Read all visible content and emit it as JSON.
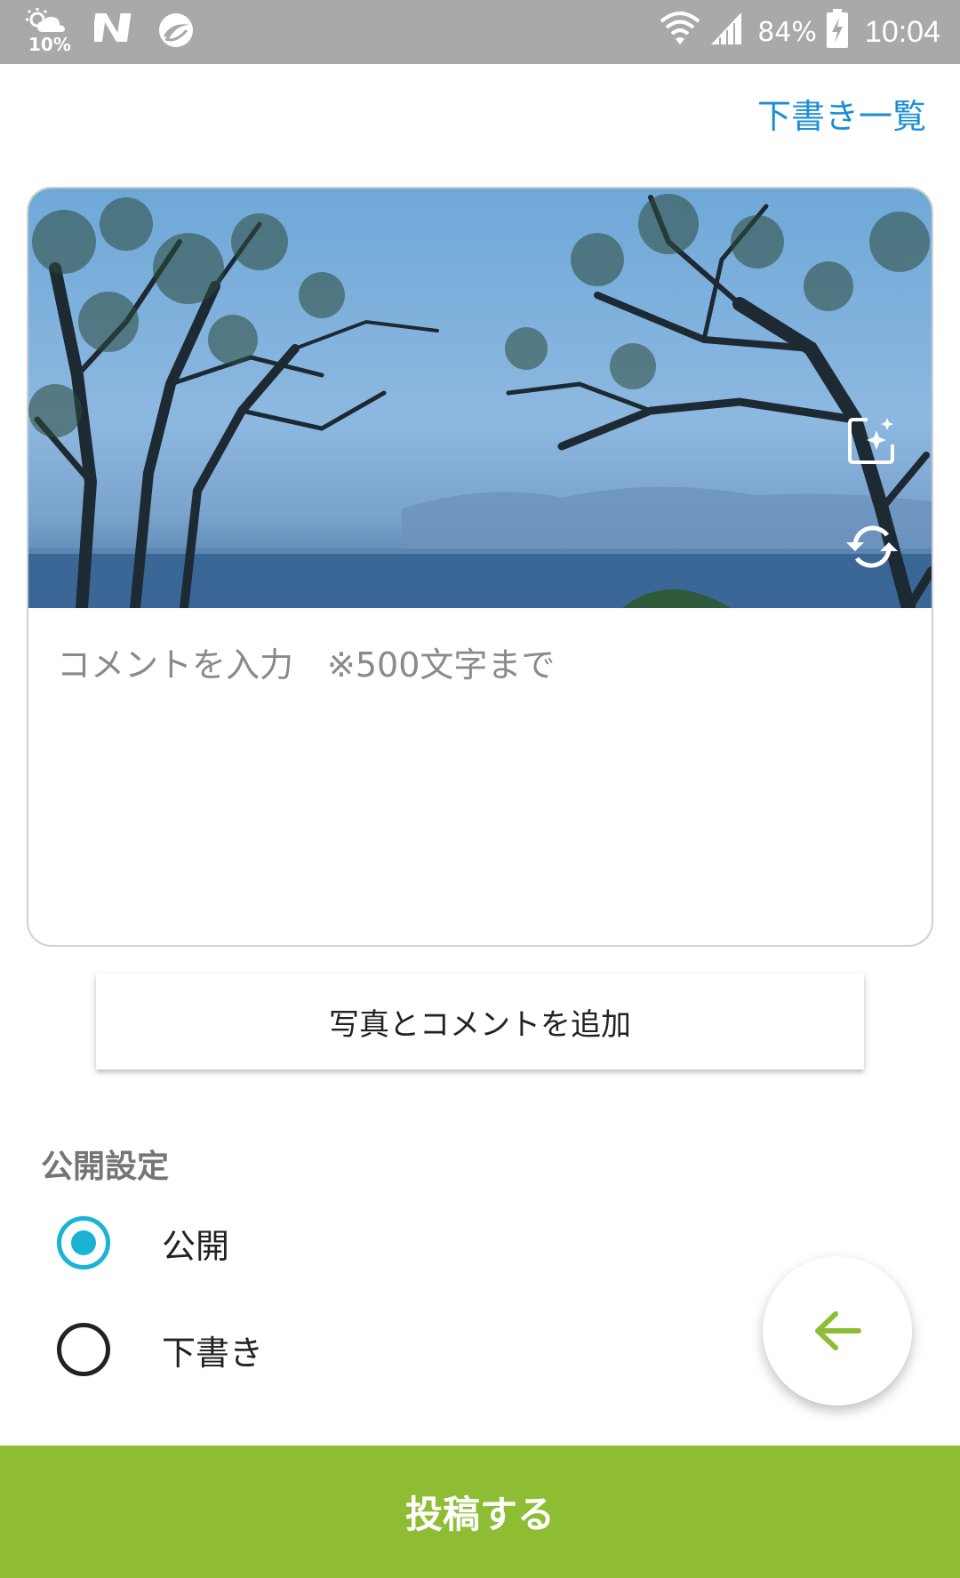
{
  "status_bar": {
    "weather_text": "10%",
    "battery_percent": "84%",
    "time": "10:04",
    "icons": [
      "weather-icon",
      "notification-n-icon",
      "app-notification-icon",
      "wifi-icon",
      "signal-icon",
      "battery-charging-icon"
    ]
  },
  "header": {
    "drafts_link": "下書き一覧"
  },
  "card": {
    "photo_alt_icons": [
      "photo-edit-icon",
      "rotate-icon"
    ],
    "comment_placeholder": "コメントを入力　※500文字まで",
    "comment_value": ""
  },
  "add_button": "写真とコメントを追加",
  "visibility": {
    "title": "公開設定",
    "options": [
      {
        "label": "公開",
        "checked": true
      },
      {
        "label": "下書き",
        "checked": false
      }
    ]
  },
  "fab": {
    "icon": "arrow-left-icon",
    "color": "#8ebd34"
  },
  "submit": {
    "label": "投稿する",
    "color": "#8ebd34"
  },
  "colors": {
    "link": "#1b8fd6",
    "radio_active": "#1ab3d3",
    "accent": "#8ebd34"
  }
}
